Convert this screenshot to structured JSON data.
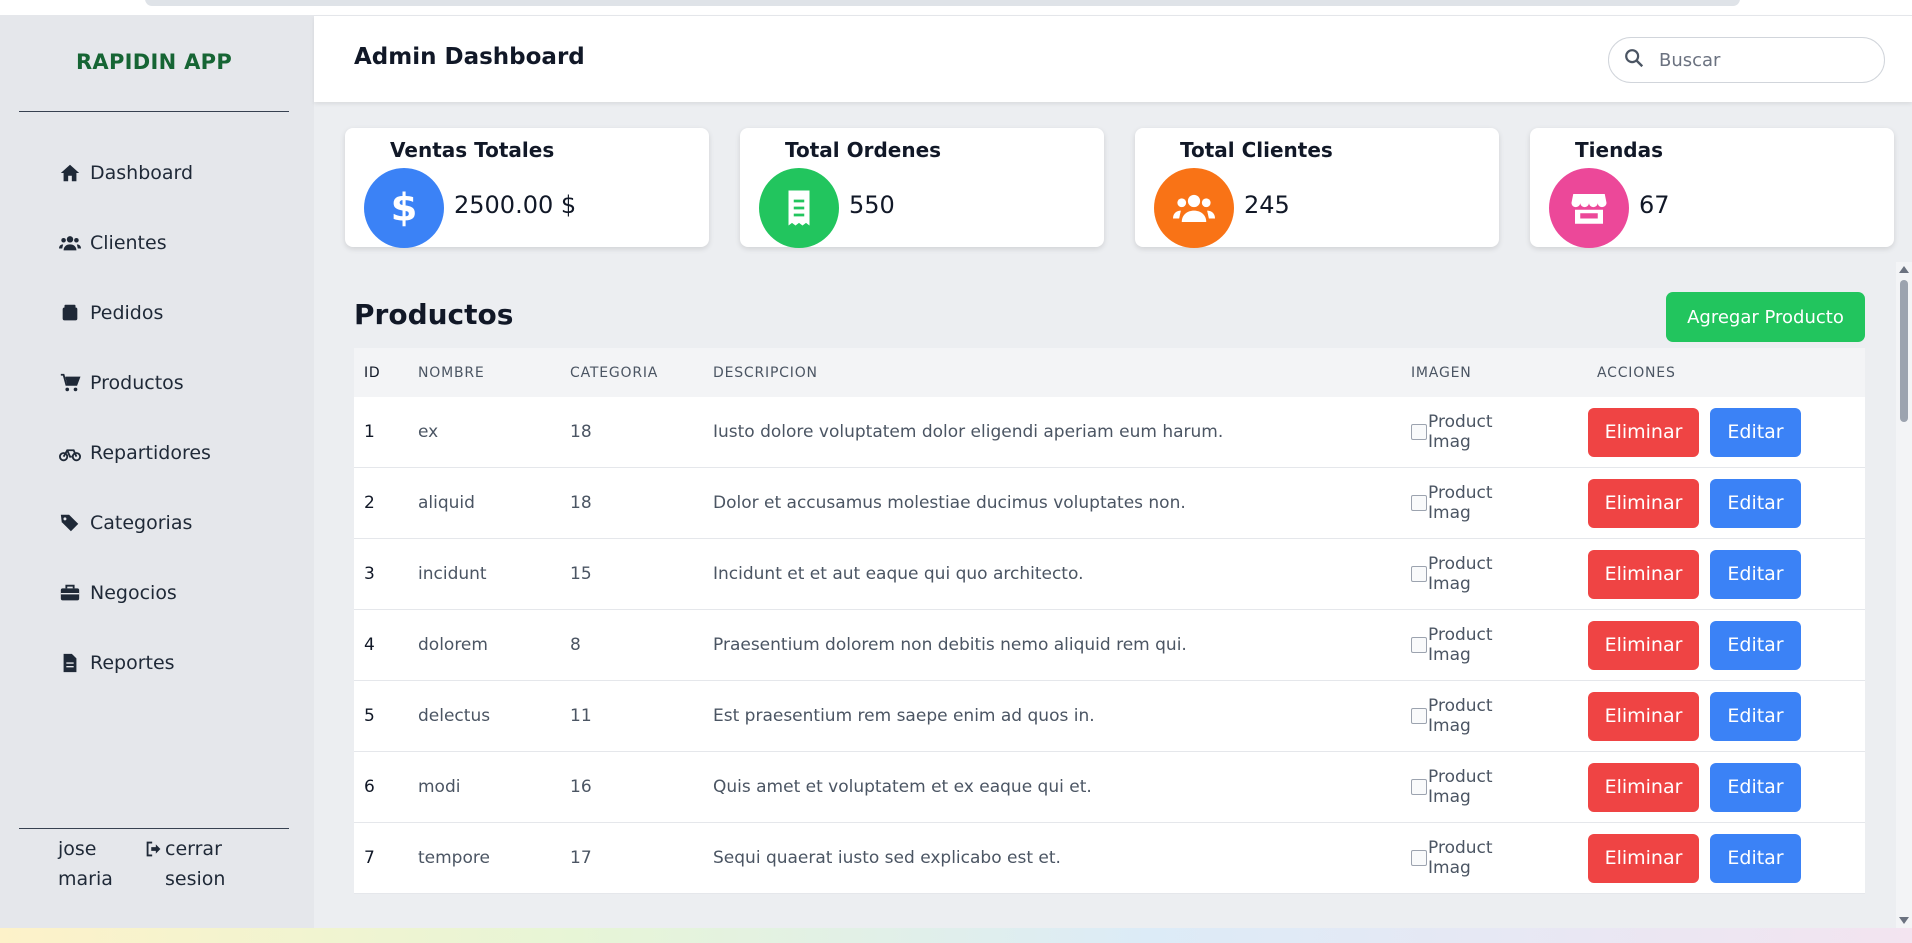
{
  "app": {
    "brand": "RAPIDIN APP"
  },
  "sidebar": {
    "items": [
      {
        "label": "Dashboard",
        "icon": "home-icon"
      },
      {
        "label": "Clientes",
        "icon": "users-icon"
      },
      {
        "label": "Pedidos",
        "icon": "box-icon"
      },
      {
        "label": "Productos",
        "icon": "cart-icon"
      },
      {
        "label": "Repartidores",
        "icon": "bicycle-icon"
      },
      {
        "label": "Categorias",
        "icon": "tags-icon"
      },
      {
        "label": "Negocios",
        "icon": "briefcase-icon"
      },
      {
        "label": "Reportes",
        "icon": "file-icon"
      }
    ],
    "user_name": "jose maria",
    "logout_label": "cerrar sesion"
  },
  "header": {
    "title": "Admin Dashboard",
    "search_placeholder": "Buscar"
  },
  "stats": [
    {
      "title": "Ventas Totales",
      "value": "2500.00 $",
      "color": "#3b82f6",
      "icon": "dollar-icon"
    },
    {
      "title": "Total Ordenes",
      "value": "550",
      "color": "#22c55e",
      "icon": "receipt-icon"
    },
    {
      "title": "Total Clientes",
      "value": "245",
      "color": "#f97316",
      "icon": "users-icon"
    },
    {
      "title": "Tiendas",
      "value": "67",
      "color": "#ec4899",
      "icon": "store-icon"
    }
  ],
  "products": {
    "title": "Productos",
    "add_label": "Agregar Producto",
    "columns": [
      "ID",
      "NOMBRE",
      "CATEGORIA",
      "DESCRIPCION",
      "IMAGEN",
      "ACCIONES"
    ],
    "image_alt": "Product Imag",
    "delete_label": "Eliminar",
    "edit_label": "Editar",
    "rows": [
      {
        "id": "1",
        "name": "ex",
        "category": "18",
        "description": "Iusto dolore voluptatem dolor eligendi aperiam eum harum."
      },
      {
        "id": "2",
        "name": "aliquid",
        "category": "18",
        "description": "Dolor et accusamus molestiae ducimus voluptates non."
      },
      {
        "id": "3",
        "name": "incidunt",
        "category": "15",
        "description": "Incidunt et et aut eaque qui quo architecto."
      },
      {
        "id": "4",
        "name": "dolorem",
        "category": "8",
        "description": "Praesentium dolorem non debitis nemo aliquid rem qui."
      },
      {
        "id": "5",
        "name": "delectus",
        "category": "11",
        "description": "Est praesentium rem saepe enim ad quos in."
      },
      {
        "id": "6",
        "name": "modi",
        "category": "16",
        "description": "Quis amet et voluptatem et ex eaque qui et."
      },
      {
        "id": "7",
        "name": "tempore",
        "category": "17",
        "description": "Sequi quaerat iusto sed explicabo est et."
      }
    ]
  },
  "colors": {
    "brand": "#166534",
    "add": "#22c55e",
    "delete": "#ef4444",
    "edit": "#3b82f6"
  }
}
